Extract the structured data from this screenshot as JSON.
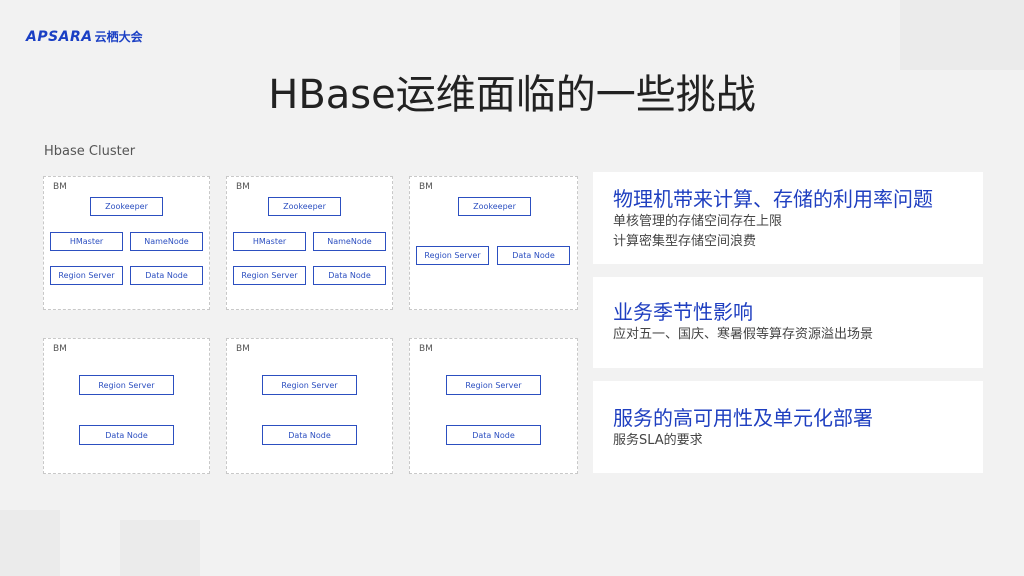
{
  "logo": {
    "mark": "APSARA",
    "text": "云栖大会"
  },
  "title": "HBase运维面临的一些挑战",
  "cluster": {
    "label": "Hbase Cluster",
    "bm_label": "BM",
    "boxes": [
      {
        "zookeeper": "Zookeeper",
        "hmaster": "HMaster",
        "namenode": "NameNode",
        "region_server": "Region Server",
        "data_node": "Data Node"
      },
      {
        "zookeeper": "Zookeeper",
        "hmaster": "HMaster",
        "namenode": "NameNode",
        "region_server": "Region Server",
        "data_node": "Data Node"
      },
      {
        "zookeeper": "Zookeeper",
        "region_server": "Region Server",
        "data_node": "Data Node"
      },
      {
        "region_server": "Region Server",
        "data_node": "Data Node"
      },
      {
        "region_server": "Region Server",
        "data_node": "Data Node"
      },
      {
        "region_server": "Region Server",
        "data_node": "Data Node"
      }
    ]
  },
  "challenges": [
    {
      "title": "物理机带来计算、存储的利用率问题",
      "lines": [
        "单核管理的存储空间存在上限",
        "计算密集型存储空间浪费"
      ]
    },
    {
      "title": "业务季节性影响",
      "lines": [
        "应对五一、国庆、寒暑假等算存资源溢出场景"
      ]
    },
    {
      "title": "服务的高可用性及单元化部署",
      "lines": [
        "服务SLA的要求"
      ]
    }
  ],
  "colors": {
    "accent": "#1f3fc0",
    "node_border": "#2c4fc0",
    "background": "#f2f2f2"
  }
}
